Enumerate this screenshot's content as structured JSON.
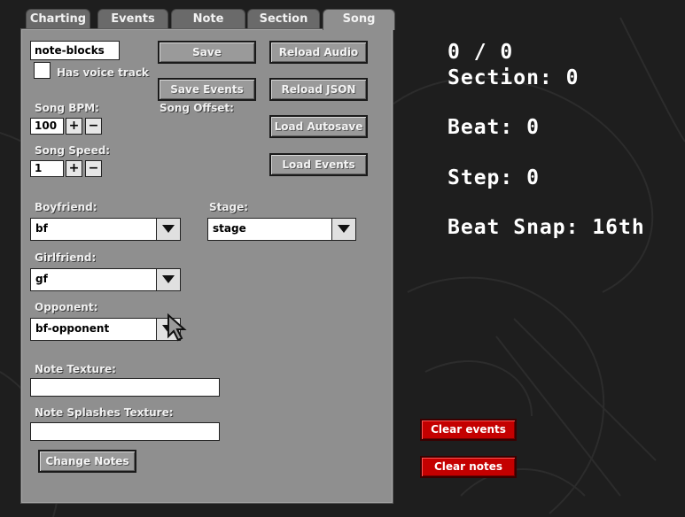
{
  "tabs": [
    {
      "label": "Charting"
    },
    {
      "label": "Events"
    },
    {
      "label": "Note"
    },
    {
      "label": "Section"
    },
    {
      "label": "Song"
    }
  ],
  "song": {
    "name_value": "note-blocks",
    "voice_track_label": "Has voice track",
    "bpm_label": "Song BPM:",
    "bpm_value": "100",
    "offset_label": "Song Offset:",
    "speed_label": "Song Speed:",
    "speed_value": "1",
    "plus": "+",
    "minus": "−"
  },
  "buttons": {
    "save": "Save",
    "reload_audio": "Reload Audio",
    "save_events": "Save Events",
    "reload_json": "Reload JSON",
    "load_autosave": "Load Autosave",
    "load_events": "Load Events",
    "change_notes": "Change Notes"
  },
  "characters": {
    "boyfriend_label": "Boyfriend:",
    "boyfriend_value": "bf",
    "stage_label": "Stage:",
    "stage_value": "stage",
    "girlfriend_label": "Girlfriend:",
    "girlfriend_value": "gf",
    "opponent_label": "Opponent:",
    "opponent_value": "bf-opponent"
  },
  "textures": {
    "note_texture_label": "Note Texture:",
    "note_texture_value": "",
    "note_splashes_label": "Note Splashes Texture:",
    "note_splashes_value": ""
  },
  "hud": {
    "time": "0 / 0",
    "section": "Section: 0",
    "beat": "Beat: 0",
    "step": "Step: 0",
    "beat_snap": "Beat Snap: 16th"
  },
  "actions": {
    "clear_events": "Clear events",
    "clear_notes": "Clear notes"
  },
  "colors": {
    "panel": "#8f8f8f",
    "danger": "#c40000",
    "background": "#1e1e1e"
  }
}
